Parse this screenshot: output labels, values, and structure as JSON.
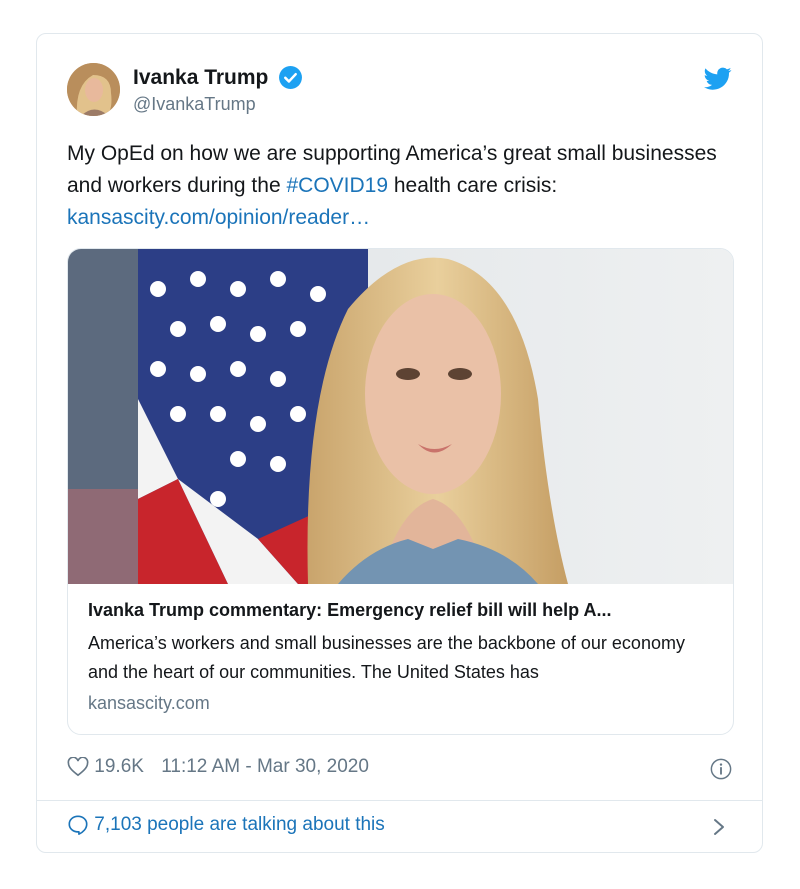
{
  "author": {
    "display_name": "Ivanka Trump",
    "handle": "@IvankaTrump",
    "avatar_icon": "profile-photo",
    "verified_icon": "verified-badge-icon",
    "verified_color": "#1da1f2"
  },
  "tweet": {
    "text_before": "My OpEd on how we are supporting America’s great small businesses and workers during the ",
    "hashtag": "#COVID19",
    "text_after": " health care crisis:",
    "link": "kansascity.com/opinion/reader…"
  },
  "card": {
    "title": "Ivanka Trump commentary: Emergency relief bill will help A...",
    "description": "America’s workers and small businesses are the backbone of our economy and the heart of our communities. The United States has",
    "domain": "kansascity.com"
  },
  "meta": {
    "likes": "19.6K",
    "timestamp": "11:12 AM - Mar 30, 2020"
  },
  "footer": {
    "talking": "7,103 people are talking about this"
  },
  "colors": {
    "accent": "#1b74b9",
    "twitter_blue": "#1da1f2",
    "muted": "#657786",
    "border": "#e1e8ed"
  }
}
